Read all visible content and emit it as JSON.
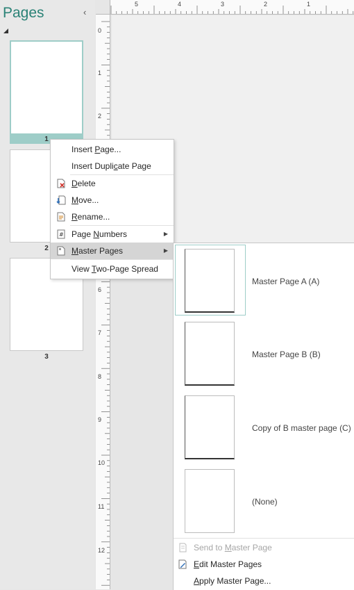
{
  "pane": {
    "title": "Pages",
    "collapse_glyph": "‹",
    "thumbs": [
      {
        "number": "1",
        "selected": true
      },
      {
        "number": "2",
        "selected": false
      },
      {
        "number": "3",
        "selected": false
      }
    ]
  },
  "ruler": {
    "horizontal_labels": [
      "5",
      "4",
      "3",
      "2",
      "1"
    ],
    "vertical_labels": [
      "0",
      "1",
      "2",
      "6",
      "7",
      "8",
      "9",
      "10",
      "11",
      "12"
    ]
  },
  "context_menu": {
    "items": [
      {
        "pre": "Insert ",
        "key": "P",
        "post": "age...",
        "icon": "",
        "arrow": false
      },
      {
        "pre": "Insert Dupli",
        "key": "c",
        "post": "ate Page",
        "icon": "",
        "arrow": false
      },
      {
        "pre": "",
        "key": "D",
        "post": "elete",
        "icon": "delete-page-icon",
        "arrow": false
      },
      {
        "pre": "",
        "key": "M",
        "post": "ove...",
        "icon": "move-page-icon",
        "arrow": false
      },
      {
        "pre": "",
        "key": "R",
        "post": "ename...",
        "icon": "rename-page-icon",
        "arrow": false
      },
      {
        "pre": "Page ",
        "key": "N",
        "post": "umbers",
        "icon": "page-numbers-icon",
        "arrow": true
      },
      {
        "pre": "",
        "key": "M",
        "post": "aster Pages",
        "icon": "master-pages-icon",
        "arrow": true
      },
      {
        "pre": "View ",
        "key": "T",
        "post": "wo-Page Spread",
        "icon": "",
        "arrow": false
      }
    ],
    "arrow_glyph": "▶"
  },
  "submenu": {
    "masters": [
      {
        "label": "Master Page A (A)",
        "selected": true
      },
      {
        "label": "Master Page B (B)",
        "selected": false
      },
      {
        "label": "Copy of B master page (C)",
        "selected": false
      },
      {
        "label": "(None)",
        "selected": false
      }
    ],
    "actions": [
      {
        "pre": "Send to ",
        "key": "M",
        "post": "aster Page",
        "disabled": true,
        "icon": "send-to-master-icon"
      },
      {
        "pre": "",
        "key": "E",
        "post": "dit Master Pages",
        "disabled": false,
        "icon": "edit-master-icon"
      },
      {
        "pre": "",
        "key": "A",
        "post": "pply Master Page...",
        "disabled": false,
        "icon": ""
      }
    ]
  },
  "colors": {
    "accent": "#2a8276",
    "selection": "#9ecdc8"
  }
}
